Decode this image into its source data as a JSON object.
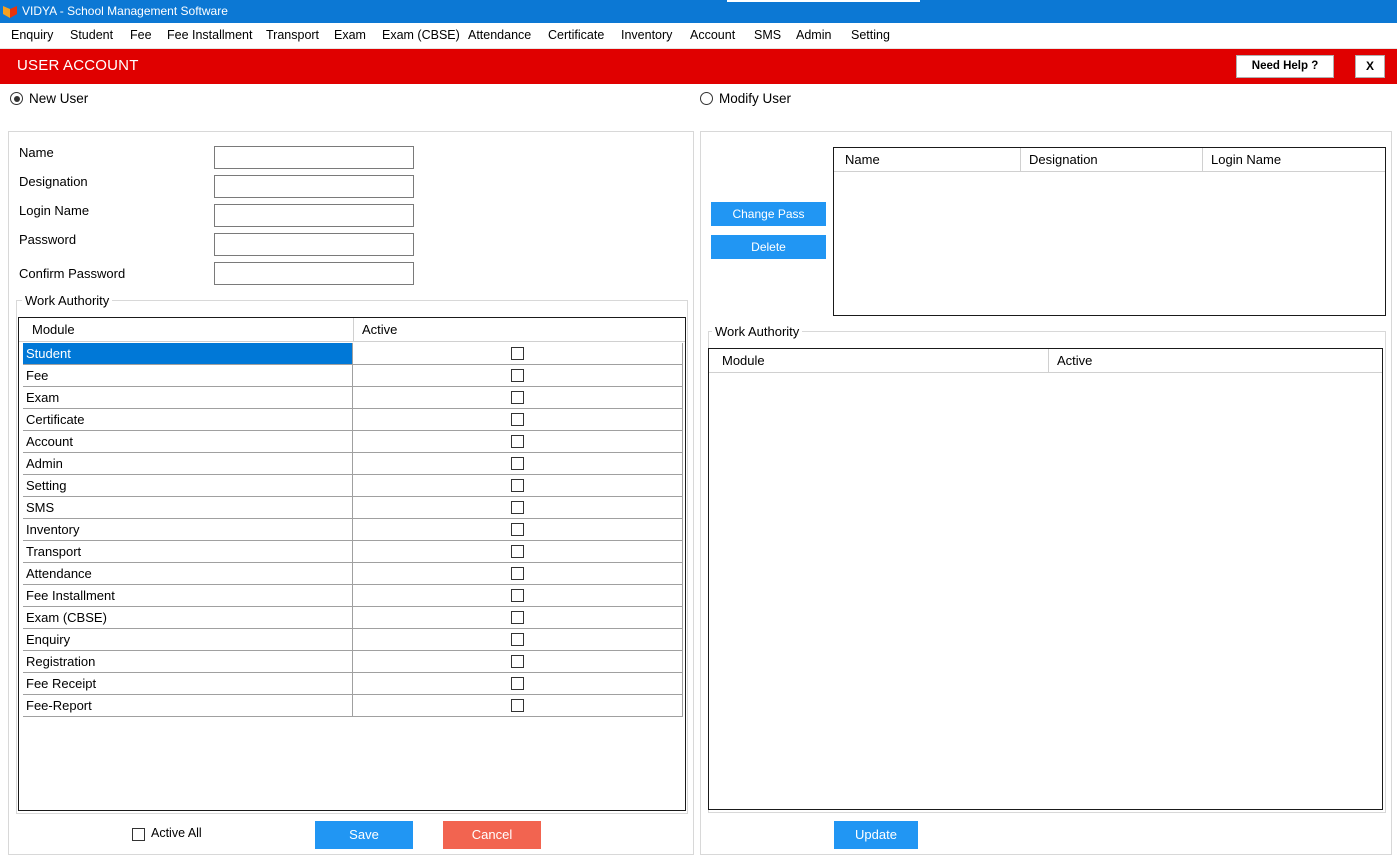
{
  "window": {
    "title": "VIDYA - School Management Software"
  },
  "menu": [
    "Enquiry",
    "Student",
    "Fee",
    "Fee Installment",
    "Transport",
    "Exam",
    "Exam (CBSE)",
    "Attendance",
    "Certificate",
    "Inventory",
    "Account",
    "SMS",
    "Admin",
    "Setting"
  ],
  "header": {
    "title": "USER ACCOUNT",
    "help_label": "Need Help ?",
    "close_label": "X",
    "color": "#e00000"
  },
  "mode": {
    "new_user_label": "New User",
    "modify_user_label": "Modify User",
    "selected": "new"
  },
  "new_user_form": {
    "fields": [
      {
        "label": "Name",
        "value": ""
      },
      {
        "label": "Designation",
        "value": ""
      },
      {
        "label": "Login Name",
        "value": ""
      },
      {
        "label": "Password",
        "value": ""
      },
      {
        "label": "Confirm Password",
        "value": ""
      }
    ],
    "work_authority_label": "Work Authority",
    "columns": [
      "Module",
      "Active"
    ],
    "modules": [
      "Student",
      "Fee",
      "Exam",
      "Certificate",
      "Account",
      "Admin",
      "Setting",
      "SMS",
      "Inventory",
      "Transport",
      "Attendance",
      "Fee Installment",
      "Exam (CBSE)",
      "Enquiry",
      "Registration",
      "Fee Receipt",
      "Fee-Report"
    ],
    "selected_module": "Student",
    "active_all_label": "Active All",
    "save_label": "Save",
    "cancel_label": "Cancel"
  },
  "modify_user": {
    "change_pass_label": "Change Pass",
    "delete_label": "Delete",
    "user_columns": [
      "Name",
      "Designation",
      "Login Name"
    ],
    "work_authority_label": "Work Authority",
    "columns": [
      "Module",
      "Active"
    ],
    "update_label": "Update"
  },
  "colors": {
    "titlebar": "#0c78d4",
    "primary_button": "#2196f3",
    "cancel_button": "#f26450",
    "selection": "#0078d7"
  }
}
